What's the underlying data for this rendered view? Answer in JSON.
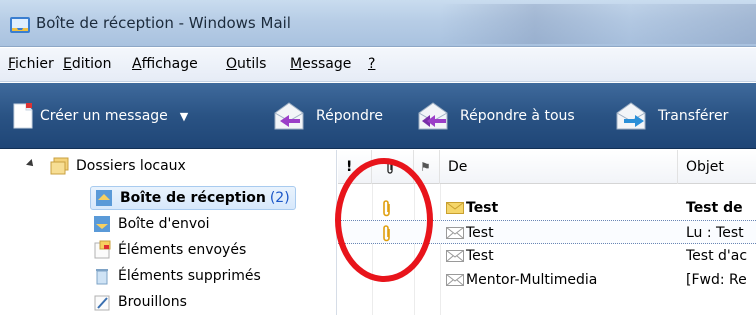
{
  "window": {
    "title": "Boîte de réception - Windows Mail",
    "icon": "inbox-app-icon"
  },
  "menu": {
    "items": [
      {
        "key": "F",
        "rest": "ichier"
      },
      {
        "key": "E",
        "rest": "dition"
      },
      {
        "key": "A",
        "rest": "ffichage"
      },
      {
        "key": "O",
        "rest": "utils"
      },
      {
        "key": "M",
        "rest": "essage"
      },
      {
        "key": "?",
        "rest": ""
      }
    ]
  },
  "toolbar": {
    "create": "Créer un message",
    "reply": "Répondre",
    "reply_all": "Répondre à tous",
    "forward": "Transférer"
  },
  "folders": {
    "root": "Dossiers locaux",
    "items": [
      {
        "label": "Boîte de réception",
        "count": "(2)",
        "selected": true,
        "icon": "inbox-icon"
      },
      {
        "label": "Boîte d'envoi",
        "icon": "outbox-icon"
      },
      {
        "label": "Éléments envoyés",
        "icon": "sent-items-icon"
      },
      {
        "label": "Éléments supprimés",
        "icon": "trash-icon"
      },
      {
        "label": "Brouillons",
        "icon": "drafts-icon"
      }
    ]
  },
  "message_list": {
    "columns": {
      "priority": "!",
      "attachment": "📎",
      "flag": "⚑",
      "from": "De",
      "subject": "Objet"
    },
    "rows": [
      {
        "attachment": true,
        "unread": true,
        "from": "Test",
        "subject": "Test de"
      },
      {
        "attachment": true,
        "unread": false,
        "focused": true,
        "from": "Test",
        "subject": "Lu : Test"
      },
      {
        "attachment": false,
        "unread": false,
        "from": "Test",
        "subject": "Test d'ac"
      },
      {
        "attachment": false,
        "unread": false,
        "from": "Mentor-Multimedia",
        "subject": "[Fwd: Re"
      }
    ]
  },
  "colors": {
    "toolbar": "#2a5384",
    "annotation": "#e8141b",
    "count": "#1a56c8"
  }
}
